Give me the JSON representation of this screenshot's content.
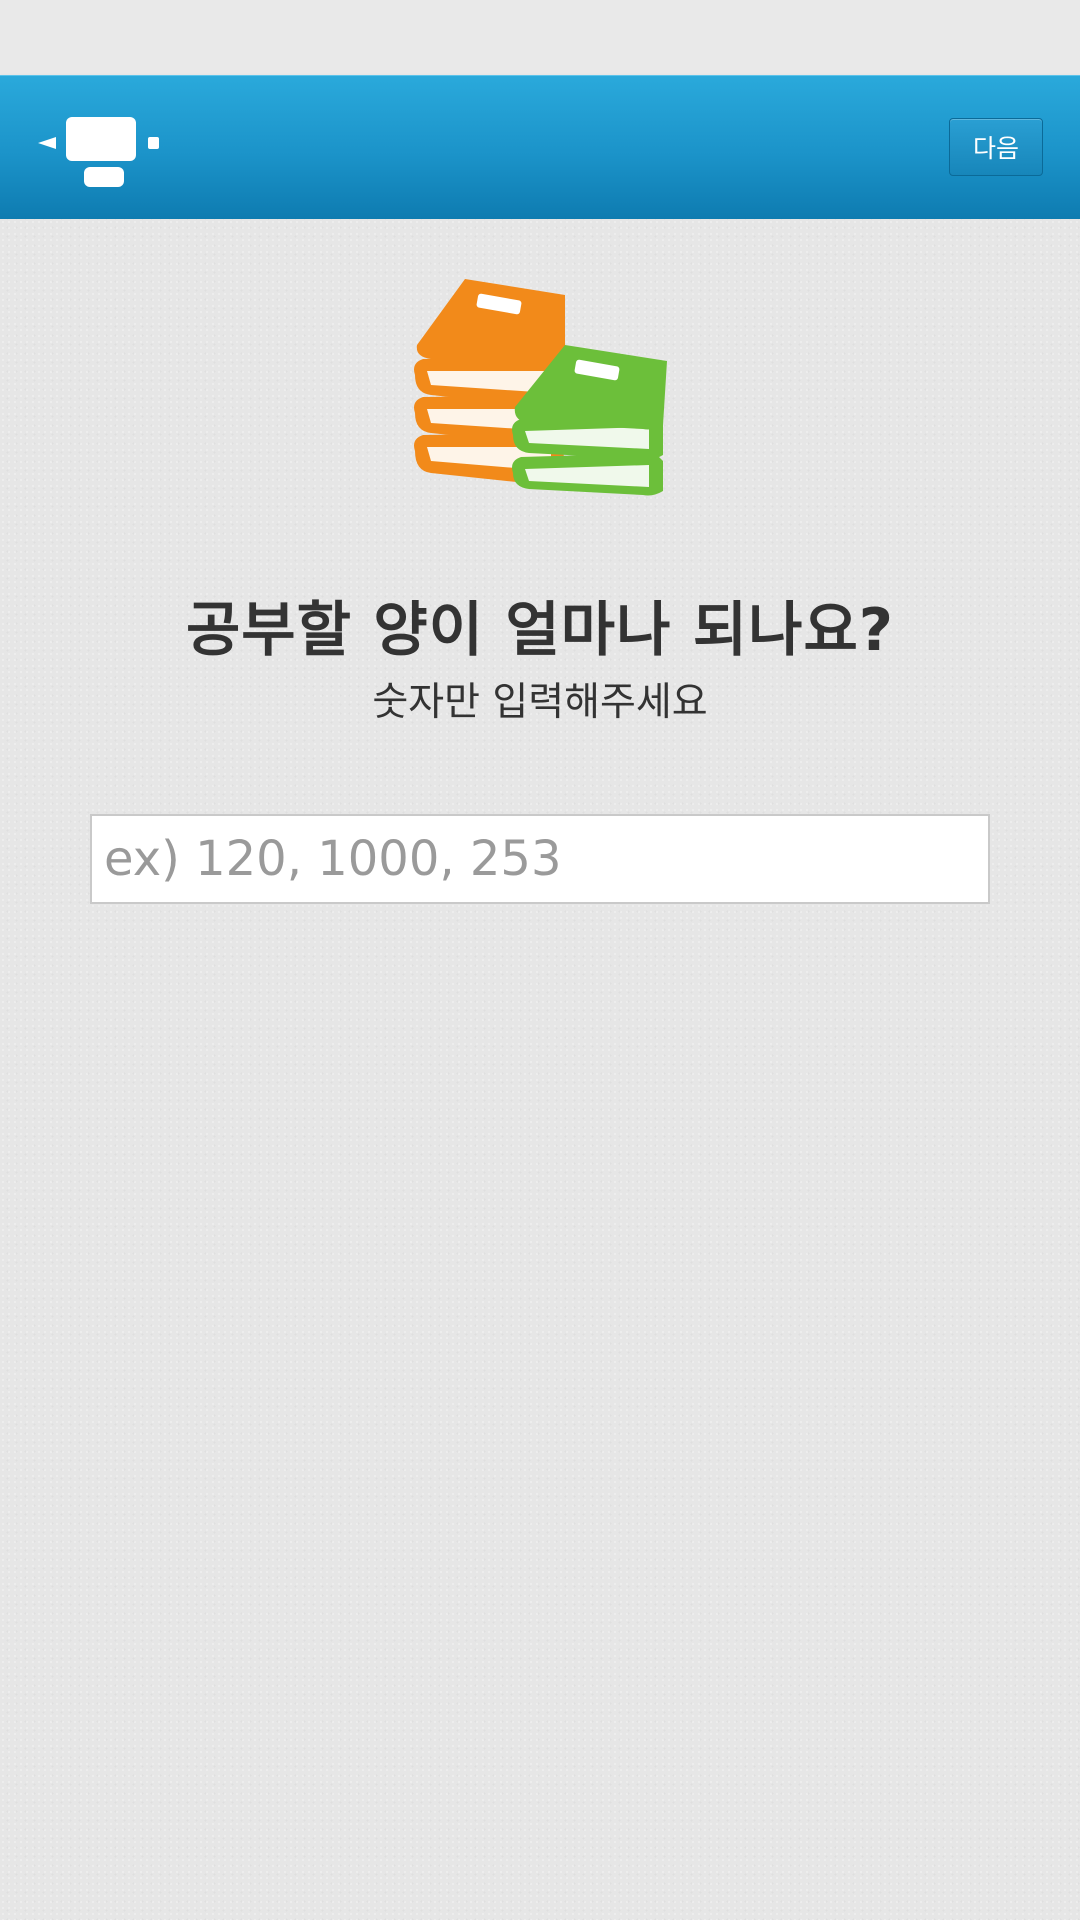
{
  "toolbar": {
    "home_icon": "presentation-board-icon",
    "next_label": "다음"
  },
  "main": {
    "illustration": "stacked-books-icon",
    "title": "공부할 양이 얼마나 되나요?",
    "subtitle": "숫자만 입력해주세요",
    "amount_input": {
      "value": "",
      "placeholder": "ex) 120, 1000, 253"
    }
  },
  "colors": {
    "app_bar": "#1b93c9",
    "book_orange": "#f28a1a",
    "book_green": "#6cbf3a",
    "text": "#333333"
  }
}
